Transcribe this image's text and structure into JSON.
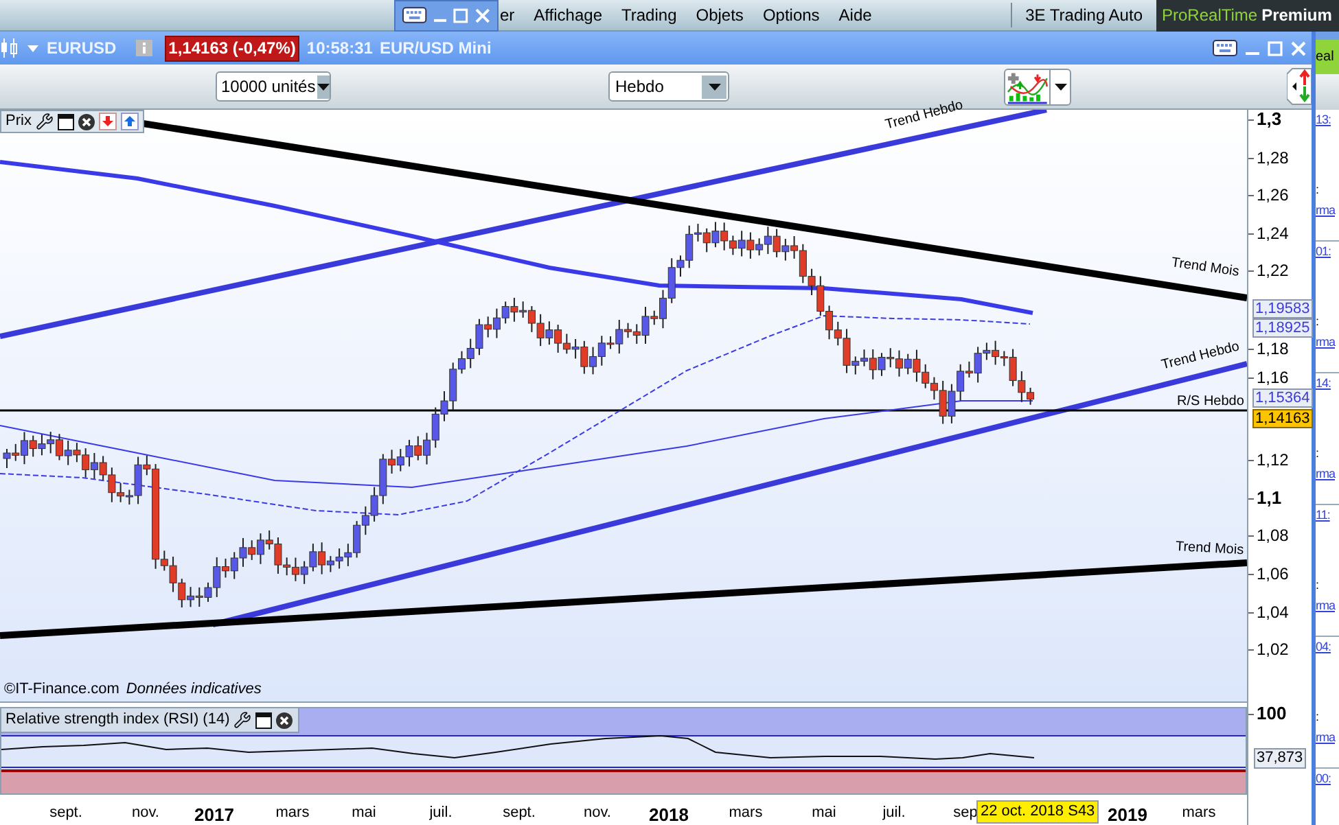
{
  "menu_bar": {
    "items": [
      {
        "label": "er"
      },
      {
        "label": "Affichage"
      },
      {
        "label": "Trading"
      },
      {
        "label": "Objets"
      },
      {
        "label": "Options"
      },
      {
        "label": "Aide"
      }
    ],
    "workspace": "3E Trading Auto",
    "brand": {
      "name": "ProRealTime",
      "edition": "Premium"
    }
  },
  "window": {
    "instrument": "EURUSD",
    "quote": "1,14163 (-0,47%)",
    "time": "10:58:31",
    "title": "EUR/USD Mini"
  },
  "toolbar": {
    "quantity": "10000 unités",
    "period": "Hebdo"
  },
  "price_panel": {
    "label": "Prix",
    "axis_ticks": [
      {
        "label": "1,3",
        "major": true
      },
      {
        "label": "1,28",
        "major": false
      },
      {
        "label": "1,26",
        "major": false
      },
      {
        "label": "1,24",
        "major": false
      },
      {
        "label": "1,22",
        "major": false
      },
      {
        "label": "1,18",
        "major": false
      },
      {
        "label": "1,16",
        "major": false
      },
      {
        "label": "1,12",
        "major": false
      },
      {
        "label": "1,1",
        "major": true
      },
      {
        "label": "1,08",
        "major": false
      },
      {
        "label": "1,06",
        "major": false
      },
      {
        "label": "1,04",
        "major": false
      },
      {
        "label": "1,02",
        "major": false
      }
    ],
    "value_labels": [
      {
        "text": "1,19583",
        "kind": "indicator"
      },
      {
        "text": "1,18925",
        "kind": "indicator"
      },
      {
        "text": "1,15364",
        "kind": "indicator"
      },
      {
        "text": "1,14163",
        "kind": "last"
      }
    ],
    "line_labels": [
      {
        "text": "Trend Hebdo"
      },
      {
        "text": "Trend Mois"
      },
      {
        "text": "Trend Hebdo"
      },
      {
        "text": "R/S Hebdo"
      },
      {
        "text": "Trend Mois"
      }
    ],
    "source": "©IT-Finance.com",
    "disclaimer": "Données indicatives"
  },
  "rsi_panel": {
    "title": "Relative strength index (RSI) (14)",
    "axis_ticks": [
      {
        "label": "100",
        "major": true
      }
    ],
    "value_label": "37,873"
  },
  "time_axis": {
    "ticks": [
      {
        "label": "sept.",
        "major": false
      },
      {
        "label": "nov.",
        "major": false
      },
      {
        "label": "2017",
        "major": true
      },
      {
        "label": "mars",
        "major": false
      },
      {
        "label": "mai",
        "major": false
      },
      {
        "label": "juil.",
        "major": false
      },
      {
        "label": "sept.",
        "major": false
      },
      {
        "label": "nov.",
        "major": false
      },
      {
        "label": "2018",
        "major": true
      },
      {
        "label": "mars",
        "major": false
      },
      {
        "label": "mai",
        "major": false
      },
      {
        "label": "juil.",
        "major": false
      },
      {
        "label": "sep",
        "major": false
      },
      {
        "label": "2019",
        "major": true
      },
      {
        "label": "mars",
        "major": false
      }
    ],
    "cursor_label": "22 oct. 2018 S43"
  },
  "side_panel": {
    "header": "eal",
    "entries": [
      {
        "time": "13:",
        "separator": ":",
        "text": "rma"
      },
      {
        "time": "01:",
        "separator": ":",
        "text": "rma"
      },
      {
        "time": "14:",
        "separator": ":",
        "text": "rma"
      },
      {
        "time": "11:",
        "separator": ":",
        "text": "rma"
      },
      {
        "time": "04:",
        "separator": ":",
        "text": "rma"
      },
      {
        "time": "00:"
      }
    ]
  }
}
